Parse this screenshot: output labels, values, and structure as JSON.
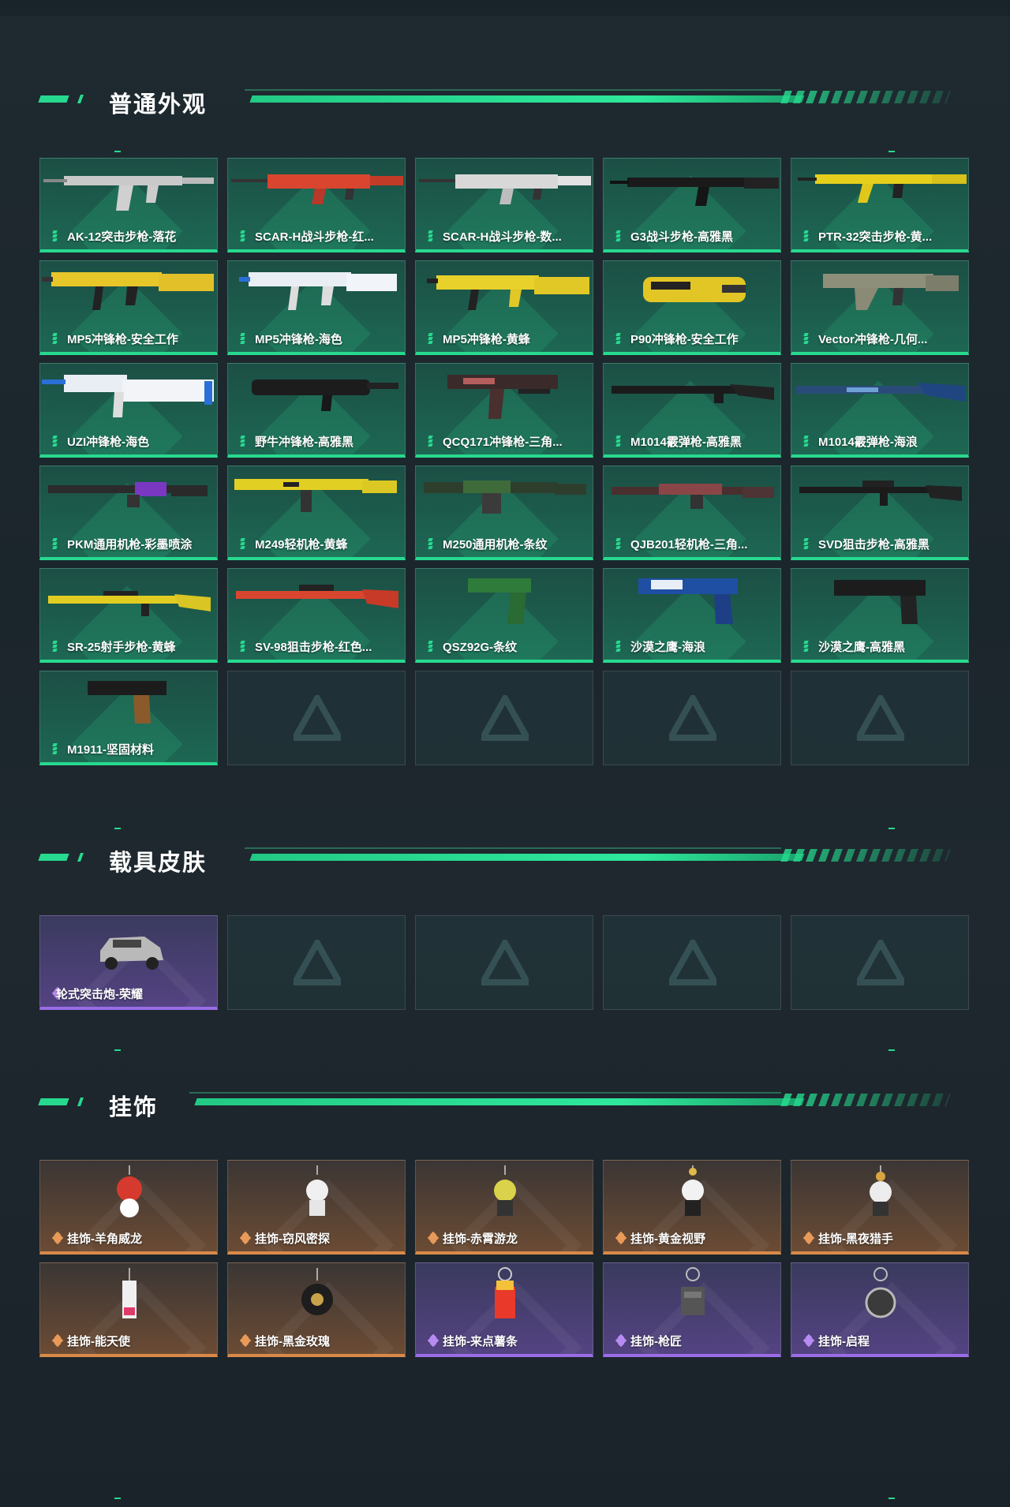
{
  "sections": [
    {
      "title": "普通外观",
      "items": [
        {
          "label": "AK-12突击步枪-落花"
        },
        {
          "label": "SCAR-H战斗步枪-红..."
        },
        {
          "label": "SCAR-H战斗步枪-数..."
        },
        {
          "label": "G3战斗步枪-高雅黑"
        },
        {
          "label": "PTR-32突击步枪-黄..."
        },
        {
          "label": "MP5冲锋枪-安全工作"
        },
        {
          "label": "MP5冲锋枪-海色"
        },
        {
          "label": "MP5冲锋枪-黄蜂"
        },
        {
          "label": "P90冲锋枪-安全工作"
        },
        {
          "label": "Vector冲锋枪-几何..."
        },
        {
          "label": "UZI冲锋枪-海色"
        },
        {
          "label": "野牛冲锋枪-高雅黑"
        },
        {
          "label": "QCQ171冲锋枪-三角..."
        },
        {
          "label": "M1014霰弹枪-高雅黑"
        },
        {
          "label": "M1014霰弹枪-海浪"
        },
        {
          "label": "PKM通用机枪-彩墨喷涂"
        },
        {
          "label": "M249轻机枪-黄蜂"
        },
        {
          "label": "M250通用机枪-条纹"
        },
        {
          "label": "QJB201轻机枪-三角..."
        },
        {
          "label": "SVD狙击步枪-高雅黑"
        },
        {
          "label": "SR-25射手步枪-黄蜂"
        },
        {
          "label": "SV-98狙击步枪-红色..."
        },
        {
          "label": "QSZ92G-条纹"
        },
        {
          "label": "沙漠之鹰-海浪"
        },
        {
          "label": "沙漠之鹰-高雅黑"
        },
        {
          "label": "M1911-坚固材料"
        }
      ]
    },
    {
      "title": "载具皮肤",
      "items": [
        {
          "label": "轮式突击炮-荣耀"
        }
      ]
    },
    {
      "title": "挂饰",
      "items": [
        {
          "label": "挂饰-羊角威龙"
        },
        {
          "label": "挂饰-窃风密探"
        },
        {
          "label": "挂饰-赤霄游龙"
        },
        {
          "label": "挂饰-黄金视野"
        },
        {
          "label": "挂饰-黑夜猎手"
        },
        {
          "label": "挂饰-能天使"
        },
        {
          "label": "挂饰-黑金玫瑰"
        },
        {
          "label": "挂饰-来点薯条"
        },
        {
          "label": "挂饰-枪匠"
        },
        {
          "label": "挂饰-启程"
        }
      ]
    }
  ],
  "colors": {
    "accent": "#27d98f",
    "common": "#27d98f",
    "epic": "#9a6ce6",
    "legendary": "#d98a48"
  }
}
